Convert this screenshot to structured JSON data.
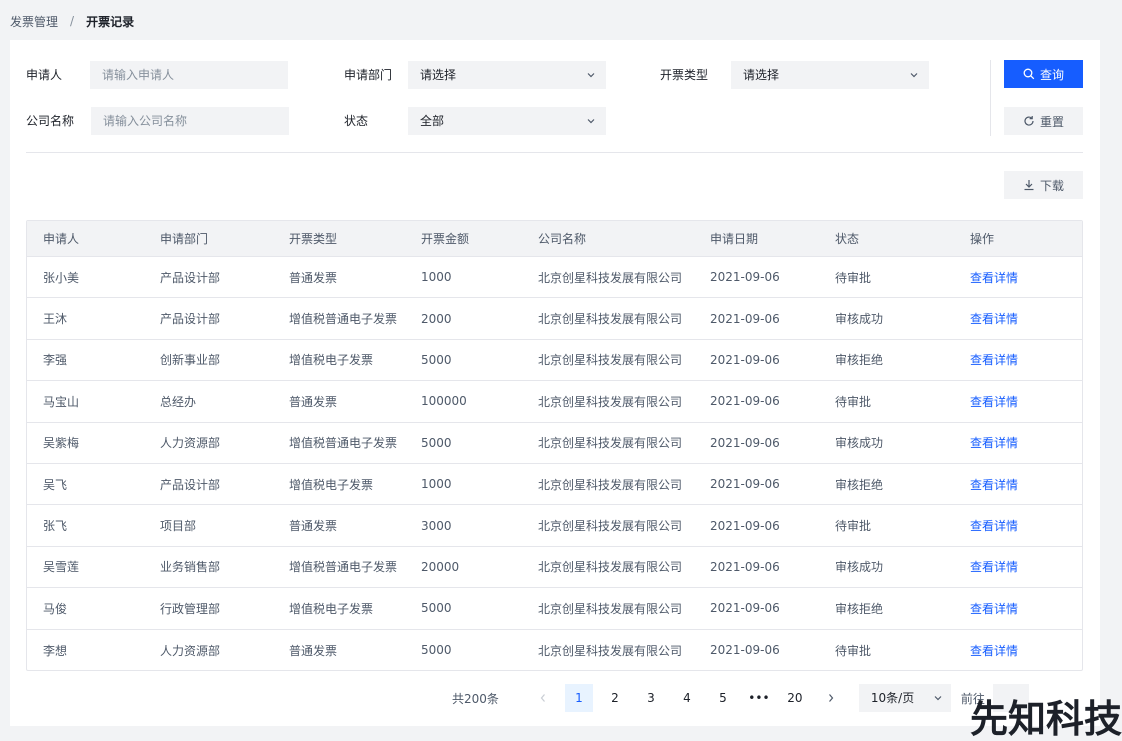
{
  "breadcrumb": {
    "parent": "发票管理",
    "separator": "/",
    "current": "开票记录"
  },
  "filters": {
    "applicant": {
      "label": "申请人",
      "placeholder": "请输入申请人"
    },
    "department": {
      "label": "申请部门",
      "value": "请选择"
    },
    "invoice_type": {
      "label": "开票类型",
      "value": "请选择"
    },
    "company": {
      "label": "公司名称",
      "placeholder": "请输入公司名称"
    },
    "status": {
      "label": "状态",
      "value": "全部"
    }
  },
  "buttons": {
    "search": "查询",
    "reset": "重置",
    "download": "下载"
  },
  "table": {
    "columns": [
      "申请人",
      "申请部门",
      "开票类型",
      "开票金额",
      "公司名称",
      "申请日期",
      "状态",
      "操作"
    ],
    "action_label": "查看详情",
    "rows": [
      [
        "张小美",
        "产品设计部",
        "普通发票",
        "1000",
        "北京创星科技发展有限公司",
        "2021-09-06",
        "待审批"
      ],
      [
        "王沐",
        "产品设计部",
        "增值税普通电子发票",
        "2000",
        "北京创星科技发展有限公司",
        "2021-09-06",
        "审核成功"
      ],
      [
        "李强",
        "创新事业部",
        "增值税电子发票",
        "5000",
        "北京创星科技发展有限公司",
        "2021-09-06",
        "审核拒绝"
      ],
      [
        "马宝山",
        "总经办",
        "普通发票",
        "100000",
        "北京创星科技发展有限公司",
        "2021-09-06",
        "待审批"
      ],
      [
        "吴紫梅",
        "人力资源部",
        "增值税普通电子发票",
        "5000",
        "北京创星科技发展有限公司",
        "2021-09-06",
        "审核成功"
      ],
      [
        "吴飞",
        "产品设计部",
        "增值税电子发票",
        "1000",
        "北京创星科技发展有限公司",
        "2021-09-06",
        "审核拒绝"
      ],
      [
        "张飞",
        "项目部",
        "普通发票",
        "3000",
        "北京创星科技发展有限公司",
        "2021-09-06",
        "待审批"
      ],
      [
        "吴雪莲",
        "业务销售部",
        "增值税普通电子发票",
        "20000",
        "北京创星科技发展有限公司",
        "2021-09-06",
        "审核成功"
      ],
      [
        "马俊",
        "行政管理部",
        "增值税电子发票",
        "5000",
        "北京创星科技发展有限公司",
        "2021-09-06",
        "审核拒绝"
      ],
      [
        "李想",
        "人力资源部",
        "普通发票",
        "5000",
        "北京创星科技发展有限公司",
        "2021-09-06",
        "待审批"
      ]
    ]
  },
  "pagination": {
    "total": "共200条",
    "pages": [
      "1",
      "2",
      "3",
      "4",
      "5",
      "•••",
      "20"
    ],
    "current": "1",
    "page_size": "10条/页",
    "goto_label": "前往"
  },
  "watermark": "先知科技",
  "colors": {
    "primary": "#165dff",
    "border": "#e5e6eb",
    "fill": "#f2f3f5"
  }
}
